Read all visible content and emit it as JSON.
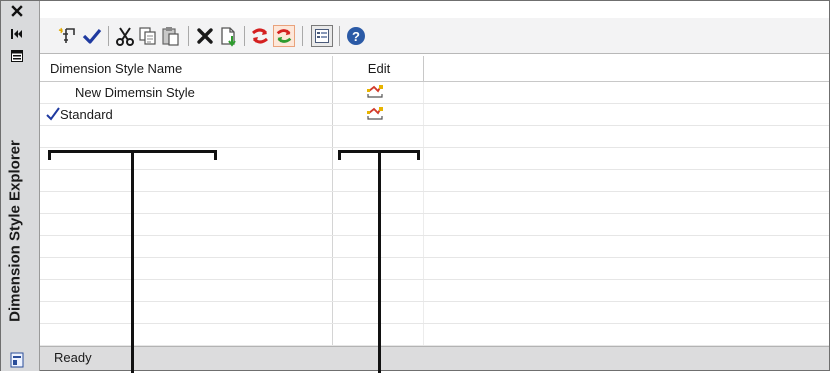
{
  "window": {
    "title": "Dimension Style Explorer"
  },
  "toolbar": {
    "buttons": [
      {
        "name": "new-style",
        "icon": "new-dimstyle-icon"
      },
      {
        "name": "set-current",
        "icon": "checkmark-icon"
      },
      {
        "name": "cut",
        "icon": "scissors-icon"
      },
      {
        "name": "copy",
        "icon": "copy-icon"
      },
      {
        "name": "paste",
        "icon": "paste-icon"
      },
      {
        "name": "delete",
        "icon": "delete-x-icon"
      },
      {
        "name": "import",
        "icon": "import-icon"
      },
      {
        "name": "purge",
        "icon": "purge-icon"
      },
      {
        "name": "purge-all",
        "icon": "purge-all-icon"
      },
      {
        "name": "views",
        "icon": "views-icon"
      },
      {
        "name": "help",
        "icon": "help-icon"
      }
    ]
  },
  "grid": {
    "columns": [
      "Dimension Style Name",
      "Edit"
    ],
    "rows": [
      {
        "name": "New Dimemsin Style",
        "current": false
      },
      {
        "name": "Standard",
        "current": true
      }
    ]
  },
  "status": {
    "text": "Ready"
  },
  "colors": {
    "check": "#1f3aa0",
    "edit_icon": "#d23a2a"
  }
}
